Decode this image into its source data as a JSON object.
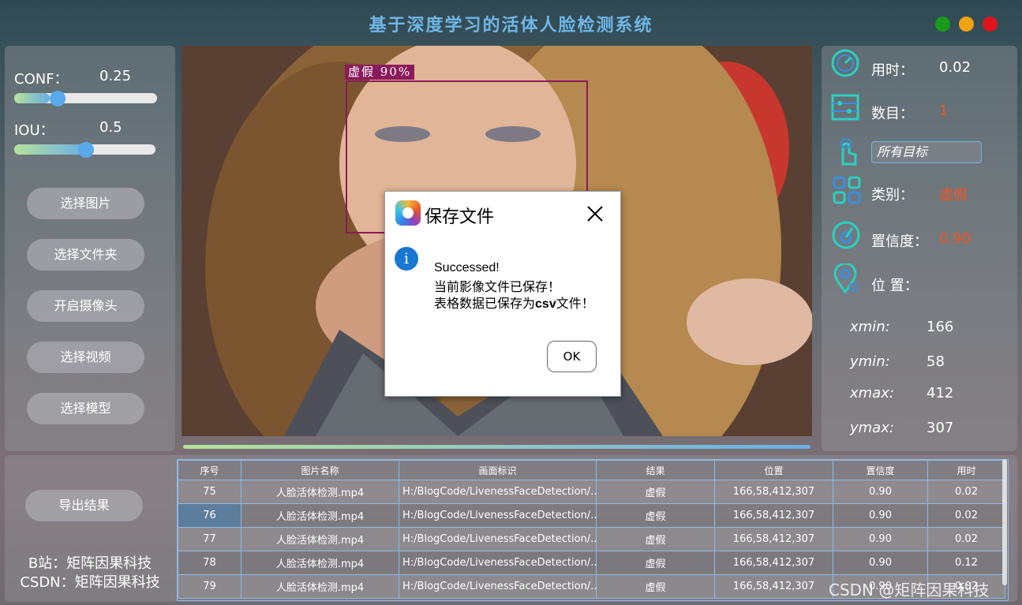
{
  "app": {
    "title": "基于深度学习的活体人脸检测系统"
  },
  "window_buttons": [
    {
      "name": "maximize",
      "color": "#1a9a1a"
    },
    {
      "name": "minimize",
      "color": "#f2a312"
    },
    {
      "name": "close",
      "color": "#e0141e"
    }
  ],
  "left": {
    "conf_label": "CONF：",
    "conf_value": "0.25",
    "conf_level": 0.25,
    "iou_label": "IOU：",
    "iou_value": "0.5",
    "iou_level": 0.5,
    "buttons": [
      "选择图片",
      "选择文件夹",
      "开启摄像头",
      "选择视频",
      "选择模型"
    ]
  },
  "detection": {
    "label": "虚假 90%",
    "box_color": "#8a1a5a"
  },
  "progress": 1.0,
  "right": {
    "time_label": "用时：",
    "time_value": "0.02",
    "count_label": "数目：",
    "count_value": "1",
    "target_select": "所有目标",
    "class_label": "类别：",
    "class_value": "虚假",
    "conf_label": "置信度：",
    "conf_value": "0.90",
    "pos_label": "位 置：",
    "xmin_label": "xmin:",
    "xmin_value": "166",
    "ymin_label": "ymin:",
    "ymin_value": "58",
    "xmax_label": "xmax:",
    "xmax_value": "412",
    "ymax_label": "ymax:",
    "ymax_value": "307",
    "value_color": "#f2551e"
  },
  "bottom": {
    "export_button": "导出结果",
    "credit1": "B站：矩阵因果科技",
    "credit2": "CSDN：矩阵因果科技"
  },
  "table": {
    "headers": [
      "序号",
      "图片名称",
      "画面标识",
      "结果",
      "位置",
      "置信度",
      "用时"
    ],
    "rows": [
      [
        "75",
        "人脸活体检测.mp4",
        "H:/BlogCode/LivenessFaceDetection/...",
        "虚假",
        "166,58,412,307",
        "0.90",
        "0.02"
      ],
      [
        "76",
        "人脸活体检测.mp4",
        "H:/BlogCode/LivenessFaceDetection/...",
        "虚假",
        "166,58,412,307",
        "0.90",
        "0.02"
      ],
      [
        "77",
        "人脸活体检测.mp4",
        "H:/BlogCode/LivenessFaceDetection/...",
        "虚假",
        "166,58,412,307",
        "0.90",
        "0.02"
      ],
      [
        "78",
        "人脸活体检测.mp4",
        "H:/BlogCode/LivenessFaceDetection/...",
        "虚假",
        "166,58,412,307",
        "0.90",
        "0.12"
      ],
      [
        "79",
        "人脸活体检测.mp4",
        "H:/BlogCode/LivenessFaceDetection/...",
        "虚假",
        "166,58,412,307",
        "0.90",
        "0.02"
      ]
    ]
  },
  "dialog": {
    "title": "保存文件",
    "line1": "Successed!",
    "line2": "当前影像文件已保存！",
    "line3_pre": "表格数据已保存为",
    "line3_bold": "csv",
    "line3_post": "文件！",
    "ok": "OK"
  },
  "watermark": "CSDN @矩阵因果科技"
}
